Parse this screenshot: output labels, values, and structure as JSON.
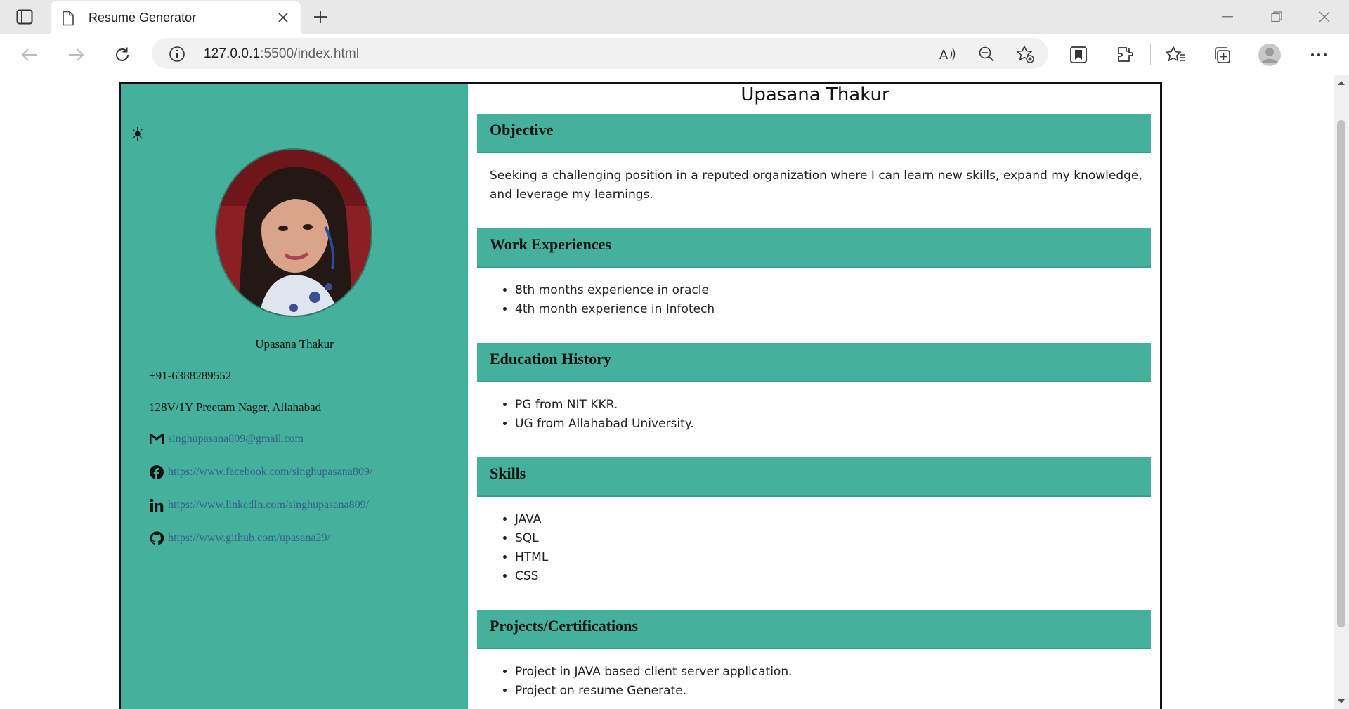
{
  "browser": {
    "tab_title": "Resume Generator",
    "url_host": "127.0.0.1",
    "url_path": ":5500/index.html"
  },
  "resume": {
    "theme_icon": "sun-icon",
    "name": "Upasana Thakur",
    "phone": "+91-6388289552",
    "address": "128V/1Y Preetam Nager, Allahabad",
    "email": "singhupasana809@gmail.com",
    "facebook": "https://www.facebook.com/singhupasana809/",
    "linkedin": "https://www.linkedIn.com/singhupasana809/",
    "github": "https://www.github.com/upasana29/",
    "objective": {
      "title": "Objective",
      "text": "Seeking a challenging position in a reputed organization where I can learn new skills, expand my knowledge, and leverage my learnings."
    },
    "work": {
      "title": "Work Experiences",
      "items": [
        "8th months experience in oracle",
        "4th month experience in Infotech"
      ]
    },
    "education": {
      "title": "Education History",
      "items": [
        "PG from NIT KKR.",
        "UG from Allahabad University."
      ]
    },
    "skills": {
      "title": "Skills",
      "items": [
        "JAVA",
        "SQL",
        "HTML",
        "CSS"
      ]
    },
    "projects": {
      "title": "Projects/Certifications",
      "items": [
        "Project in JAVA based client server application.",
        "Project on resume Generate."
      ]
    }
  }
}
